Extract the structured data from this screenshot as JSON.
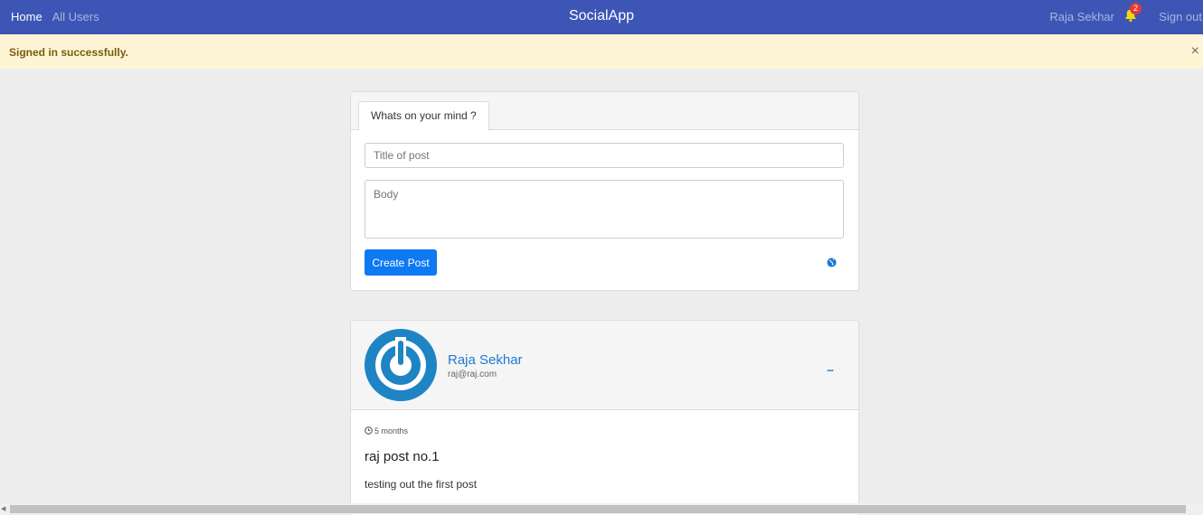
{
  "nav": {
    "home": "Home",
    "all_users": "All Users",
    "brand": "SocialApp",
    "user": "Raja Sekhar",
    "notifications": "2",
    "signout": "Sign out"
  },
  "alert": {
    "message": "Signed in successfully.",
    "close": "×"
  },
  "compose": {
    "tab": "Whats on your mind ?",
    "title_placeholder": "Title of post",
    "body_placeholder": "Body",
    "submit": "Create Post"
  },
  "post": {
    "author": "Raja Sekhar",
    "email": "raj@raj.com",
    "time": "5 months",
    "title": "raj post no.1",
    "body": "testing out the first post",
    "more": "..."
  },
  "colors": {
    "navbar": "#3d56b6",
    "alert_bg": "#fdf5d4",
    "primary": "#0d79f2",
    "link": "#1e78d4"
  },
  "icons": [
    "bell-icon",
    "close-icon",
    "globe-icon",
    "power-icon",
    "clock-icon",
    "more-icon"
  ]
}
